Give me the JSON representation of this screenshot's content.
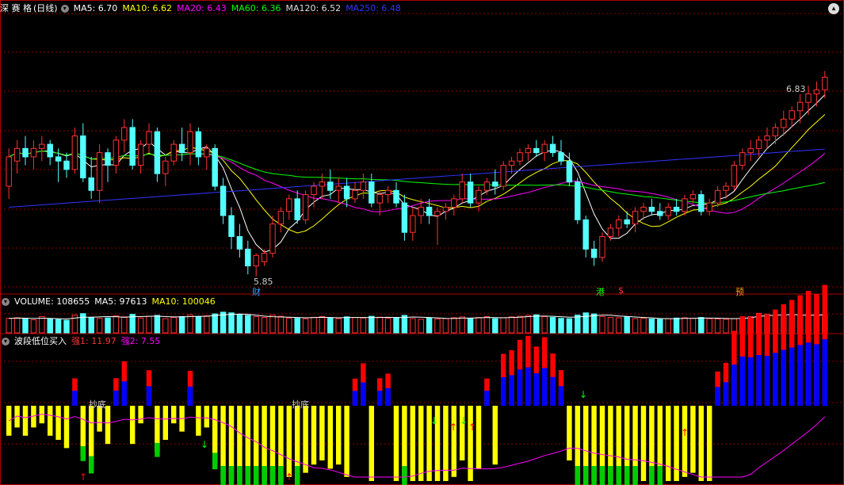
{
  "main_panel": {
    "stock_name": "深 赛 格",
    "period": "(日线)",
    "ma_labels": [
      {
        "text": "MA5: 6.70",
        "color": "#ffffff"
      },
      {
        "text": "MA10: 6.62",
        "color": "#ffff00"
      },
      {
        "text": "MA20: 6.43",
        "color": "#ff00ff"
      },
      {
        "text": "MA60: 6.36",
        "color": "#00ff00"
      },
      {
        "text": "MA120: 6.52",
        "color": "#dddddd"
      },
      {
        "text": "MA250: 6.48",
        "color": "#3333ff"
      }
    ],
    "high_label": "6.83",
    "low_label": "5.85",
    "markers": [
      {
        "text": "财",
        "color": "#3399ff"
      },
      {
        "text": "港",
        "color": "#00ff00"
      },
      {
        "text": "$",
        "color": "#ff3333"
      },
      {
        "text": "预",
        "color": "#ff9900"
      }
    ]
  },
  "volume_panel": {
    "labels": [
      {
        "text": "VOLUME: 108655",
        "color": "#ffffff"
      },
      {
        "text": "MA5: 97613",
        "color": "#ffffff"
      },
      {
        "text": "MA10: 100046",
        "color": "#ffff00"
      }
    ]
  },
  "indicator_panel": {
    "title": "波段低位买入",
    "labels": [
      {
        "text": "强1: 11.97",
        "color": "#ff3333"
      },
      {
        "text": "强2: 7.55",
        "color": "#ff00ff"
      }
    ],
    "annotations": [
      "抄底",
      "抄底"
    ]
  },
  "colors": {
    "up": "#ff3232",
    "down": "#54ffff",
    "grid": "#8b0000",
    "border": "#b00000"
  },
  "chart_data": {
    "type": "candlestick",
    "x": "trading days (unlabeled)",
    "candles": [
      {
        "o": 6.28,
        "h": 6.46,
        "l": 6.22,
        "c": 6.42
      },
      {
        "o": 6.4,
        "h": 6.5,
        "l": 6.34,
        "c": 6.46
      },
      {
        "o": 6.46,
        "h": 6.52,
        "l": 6.38,
        "c": 6.42
      },
      {
        "o": 6.42,
        "h": 6.5,
        "l": 6.36,
        "c": 6.46
      },
      {
        "o": 6.46,
        "h": 6.52,
        "l": 6.4,
        "c": 6.48
      },
      {
        "o": 6.48,
        "h": 6.5,
        "l": 6.38,
        "c": 6.42
      },
      {
        "o": 6.42,
        "h": 6.46,
        "l": 6.3,
        "c": 6.4
      },
      {
        "o": 6.4,
        "h": 6.44,
        "l": 6.32,
        "c": 6.36
      },
      {
        "o": 6.36,
        "h": 6.56,
        "l": 6.34,
        "c": 6.52
      },
      {
        "o": 6.52,
        "h": 6.58,
        "l": 6.3,
        "c": 6.32
      },
      {
        "o": 6.32,
        "h": 6.42,
        "l": 6.22,
        "c": 6.26
      },
      {
        "o": 6.26,
        "h": 6.48,
        "l": 6.2,
        "c": 6.44
      },
      {
        "o": 6.44,
        "h": 6.46,
        "l": 6.3,
        "c": 6.38
      },
      {
        "o": 6.38,
        "h": 6.52,
        "l": 6.34,
        "c": 6.5
      },
      {
        "o": 6.5,
        "h": 6.6,
        "l": 6.44,
        "c": 6.56
      },
      {
        "o": 6.56,
        "h": 6.6,
        "l": 6.36,
        "c": 6.38
      },
      {
        "o": 6.38,
        "h": 6.5,
        "l": 6.34,
        "c": 6.48
      },
      {
        "o": 6.48,
        "h": 6.58,
        "l": 6.44,
        "c": 6.54
      },
      {
        "o": 6.54,
        "h": 6.56,
        "l": 6.3,
        "c": 6.34
      },
      {
        "o": 6.34,
        "h": 6.42,
        "l": 6.28,
        "c": 6.4
      },
      {
        "o": 6.4,
        "h": 6.5,
        "l": 6.38,
        "c": 6.48
      },
      {
        "o": 6.48,
        "h": 6.56,
        "l": 6.4,
        "c": 6.44
      },
      {
        "o": 6.44,
        "h": 6.58,
        "l": 6.38,
        "c": 6.54
      },
      {
        "o": 6.54,
        "h": 6.56,
        "l": 6.38,
        "c": 6.42
      },
      {
        "o": 6.42,
        "h": 6.48,
        "l": 6.36,
        "c": 6.46
      },
      {
        "o": 6.46,
        "h": 6.48,
        "l": 6.26,
        "c": 6.28
      },
      {
        "o": 6.28,
        "h": 6.32,
        "l": 6.1,
        "c": 6.14
      },
      {
        "o": 6.14,
        "h": 6.18,
        "l": 5.98,
        "c": 6.04
      },
      {
        "o": 6.04,
        "h": 6.1,
        "l": 5.94,
        "c": 5.98
      },
      {
        "o": 5.98,
        "h": 6.02,
        "l": 5.86,
        "c": 5.9
      },
      {
        "o": 5.9,
        "h": 5.96,
        "l": 5.85,
        "c": 5.95
      },
      {
        "o": 5.92,
        "h": 5.98,
        "l": 5.9,
        "c": 5.96
      },
      {
        "o": 5.96,
        "h": 6.14,
        "l": 5.94,
        "c": 6.1
      },
      {
        "o": 6.1,
        "h": 6.18,
        "l": 6.06,
        "c": 6.16
      },
      {
        "o": 6.16,
        "h": 6.24,
        "l": 6.12,
        "c": 6.22
      },
      {
        "o": 6.22,
        "h": 6.26,
        "l": 6.1,
        "c": 6.12
      },
      {
        "o": 6.12,
        "h": 6.26,
        "l": 6.1,
        "c": 6.24
      },
      {
        "o": 6.24,
        "h": 6.3,
        "l": 6.18,
        "c": 6.28
      },
      {
        "o": 6.28,
        "h": 6.34,
        "l": 6.22,
        "c": 6.3
      },
      {
        "o": 6.3,
        "h": 6.36,
        "l": 6.22,
        "c": 6.26
      },
      {
        "o": 6.26,
        "h": 6.32,
        "l": 6.2,
        "c": 6.28
      },
      {
        "o": 6.28,
        "h": 6.32,
        "l": 6.18,
        "c": 6.22
      },
      {
        "o": 6.22,
        "h": 6.3,
        "l": 6.2,
        "c": 6.26
      },
      {
        "o": 6.26,
        "h": 6.34,
        "l": 6.22,
        "c": 6.3
      },
      {
        "o": 6.3,
        "h": 6.34,
        "l": 6.18,
        "c": 6.2
      },
      {
        "o": 6.2,
        "h": 6.26,
        "l": 6.14,
        "c": 6.24
      },
      {
        "o": 6.24,
        "h": 6.28,
        "l": 6.2,
        "c": 6.26
      },
      {
        "o": 6.26,
        "h": 6.3,
        "l": 6.18,
        "c": 6.2
      },
      {
        "o": 6.2,
        "h": 6.24,
        "l": 6.02,
        "c": 6.06
      },
      {
        "o": 6.06,
        "h": 6.18,
        "l": 6.02,
        "c": 6.14
      },
      {
        "o": 6.14,
        "h": 6.22,
        "l": 6.1,
        "c": 6.18
      },
      {
        "o": 6.18,
        "h": 6.22,
        "l": 6.1,
        "c": 6.14
      },
      {
        "o": 6.14,
        "h": 6.18,
        "l": 6.0,
        "c": 6.16
      },
      {
        "o": 6.16,
        "h": 6.2,
        "l": 6.12,
        "c": 6.18
      },
      {
        "o": 6.18,
        "h": 6.24,
        "l": 6.14,
        "c": 6.22
      },
      {
        "o": 6.22,
        "h": 6.34,
        "l": 6.2,
        "c": 6.3
      },
      {
        "o": 6.3,
        "h": 6.34,
        "l": 6.18,
        "c": 6.2
      },
      {
        "o": 6.2,
        "h": 6.28,
        "l": 6.16,
        "c": 6.26
      },
      {
        "o": 6.26,
        "h": 6.32,
        "l": 6.24,
        "c": 6.3
      },
      {
        "o": 6.3,
        "h": 6.36,
        "l": 6.24,
        "c": 6.28
      },
      {
        "o": 6.28,
        "h": 6.4,
        "l": 6.26,
        "c": 6.38
      },
      {
        "o": 6.38,
        "h": 6.42,
        "l": 6.34,
        "c": 6.4
      },
      {
        "o": 6.4,
        "h": 6.46,
        "l": 6.38,
        "c": 6.44
      },
      {
        "o": 6.44,
        "h": 6.48,
        "l": 6.4,
        "c": 6.46
      },
      {
        "o": 6.46,
        "h": 6.5,
        "l": 6.42,
        "c": 6.44
      },
      {
        "o": 6.44,
        "h": 6.5,
        "l": 6.4,
        "c": 6.48
      },
      {
        "o": 6.48,
        "h": 6.52,
        "l": 6.42,
        "c": 6.44
      },
      {
        "o": 6.44,
        "h": 6.5,
        "l": 6.38,
        "c": 6.4
      },
      {
        "o": 6.4,
        "h": 6.44,
        "l": 6.28,
        "c": 6.3
      },
      {
        "o": 6.3,
        "h": 6.32,
        "l": 6.1,
        "c": 6.12
      },
      {
        "o": 6.12,
        "h": 6.14,
        "l": 5.94,
        "c": 5.98
      },
      {
        "o": 5.98,
        "h": 6.02,
        "l": 5.9,
        "c": 5.94
      },
      {
        "o": 5.94,
        "h": 6.06,
        "l": 5.92,
        "c": 6.04
      },
      {
        "o": 6.04,
        "h": 6.1,
        "l": 6.02,
        "c": 6.08
      },
      {
        "o": 6.08,
        "h": 6.14,
        "l": 6.04,
        "c": 6.12
      },
      {
        "o": 6.12,
        "h": 6.16,
        "l": 6.08,
        "c": 6.1
      },
      {
        "o": 6.1,
        "h": 6.18,
        "l": 6.06,
        "c": 6.16
      },
      {
        "o": 6.16,
        "h": 6.2,
        "l": 6.12,
        "c": 6.18
      },
      {
        "o": 6.18,
        "h": 6.22,
        "l": 6.14,
        "c": 6.16
      },
      {
        "o": 6.16,
        "h": 6.2,
        "l": 6.12,
        "c": 6.14
      },
      {
        "o": 6.14,
        "h": 6.2,
        "l": 6.12,
        "c": 6.18
      },
      {
        "o": 6.18,
        "h": 6.22,
        "l": 6.14,
        "c": 6.16
      },
      {
        "o": 6.16,
        "h": 6.24,
        "l": 6.14,
        "c": 6.22
      },
      {
        "o": 6.22,
        "h": 6.26,
        "l": 6.2,
        "c": 6.24
      },
      {
        "o": 6.24,
        "h": 6.26,
        "l": 6.14,
        "c": 6.16
      },
      {
        "o": 6.16,
        "h": 6.22,
        "l": 6.14,
        "c": 6.2
      },
      {
        "o": 6.2,
        "h": 6.28,
        "l": 6.18,
        "c": 6.26
      },
      {
        "o": 6.26,
        "h": 6.3,
        "l": 6.22,
        "c": 6.28
      },
      {
        "o": 6.28,
        "h": 6.4,
        "l": 6.26,
        "c": 6.38
      },
      {
        "o": 6.38,
        "h": 6.46,
        "l": 6.36,
        "c": 6.44
      },
      {
        "o": 6.44,
        "h": 6.5,
        "l": 6.4,
        "c": 6.46
      },
      {
        "o": 6.46,
        "h": 6.52,
        "l": 6.42,
        "c": 6.5
      },
      {
        "o": 6.5,
        "h": 6.56,
        "l": 6.46,
        "c": 6.52
      },
      {
        "o": 6.52,
        "h": 6.58,
        "l": 6.48,
        "c": 6.56
      },
      {
        "o": 6.56,
        "h": 6.64,
        "l": 6.52,
        "c": 6.6
      },
      {
        "o": 6.6,
        "h": 6.66,
        "l": 6.56,
        "c": 6.64
      },
      {
        "o": 6.64,
        "h": 6.72,
        "l": 6.58,
        "c": 6.68
      },
      {
        "o": 6.68,
        "h": 6.76,
        "l": 6.62,
        "c": 6.72
      },
      {
        "o": 6.72,
        "h": 6.78,
        "l": 6.66,
        "c": 6.74
      },
      {
        "o": 6.74,
        "h": 6.83,
        "l": 6.7,
        "c": 6.8
      }
    ],
    "volume": [
      98,
      102,
      95,
      88,
      110,
      96,
      90,
      85,
      120,
      130,
      105,
      98,
      100,
      115,
      108,
      125,
      100,
      112,
      118,
      96,
      104,
      110,
      122,
      108,
      115,
      128,
      140,
      135,
      126,
      118,
      110,
      104,
      120,
      112,
      100,
      98,
      95,
      105,
      110,
      102,
      96,
      108,
      104,
      100,
      112,
      106,
      98,
      104,
      118,
      96,
      92,
      100,
      94,
      96,
      102,
      108,
      98,
      104,
      110,
      96,
      102,
      108,
      112,
      118,
      122,
      110,
      104,
      98,
      96,
      120,
      135,
      128,
      110,
      104,
      102,
      108,
      96,
      98,
      94,
      92,
      96,
      100,
      102,
      98,
      104,
      96,
      94,
      92,
      96,
      100,
      110,
      132,
      126,
      118,
      120,
      124,
      118,
      116,
      122,
      125
    ],
    "volume_ma5": [
      98,
      100,
      99,
      97,
      99,
      98,
      96,
      94,
      100,
      106,
      106,
      108,
      110,
      109,
      105,
      109,
      110,
      112,
      113,
      110,
      108,
      108,
      110,
      112,
      112,
      117,
      122,
      124,
      127,
      125,
      119,
      113,
      109,
      107,
      106,
      104,
      102,
      103,
      105,
      104,
      102,
      104,
      104,
      104,
      103,
      104,
      105,
      103,
      104,
      107,
      106,
      104,
      101,
      98,
      97,
      100,
      100,
      102,
      104,
      103,
      102,
      104,
      106,
      110,
      113,
      113,
      112,
      109,
      106,
      107,
      111,
      116,
      120,
      119,
      114,
      111,
      107,
      104,
      102,
      97,
      96,
      96,
      98,
      98,
      100,
      100,
      99,
      97,
      96,
      98,
      102,
      112,
      116,
      120,
      122,
      124,
      121,
      120,
      120,
      121
    ]
  }
}
